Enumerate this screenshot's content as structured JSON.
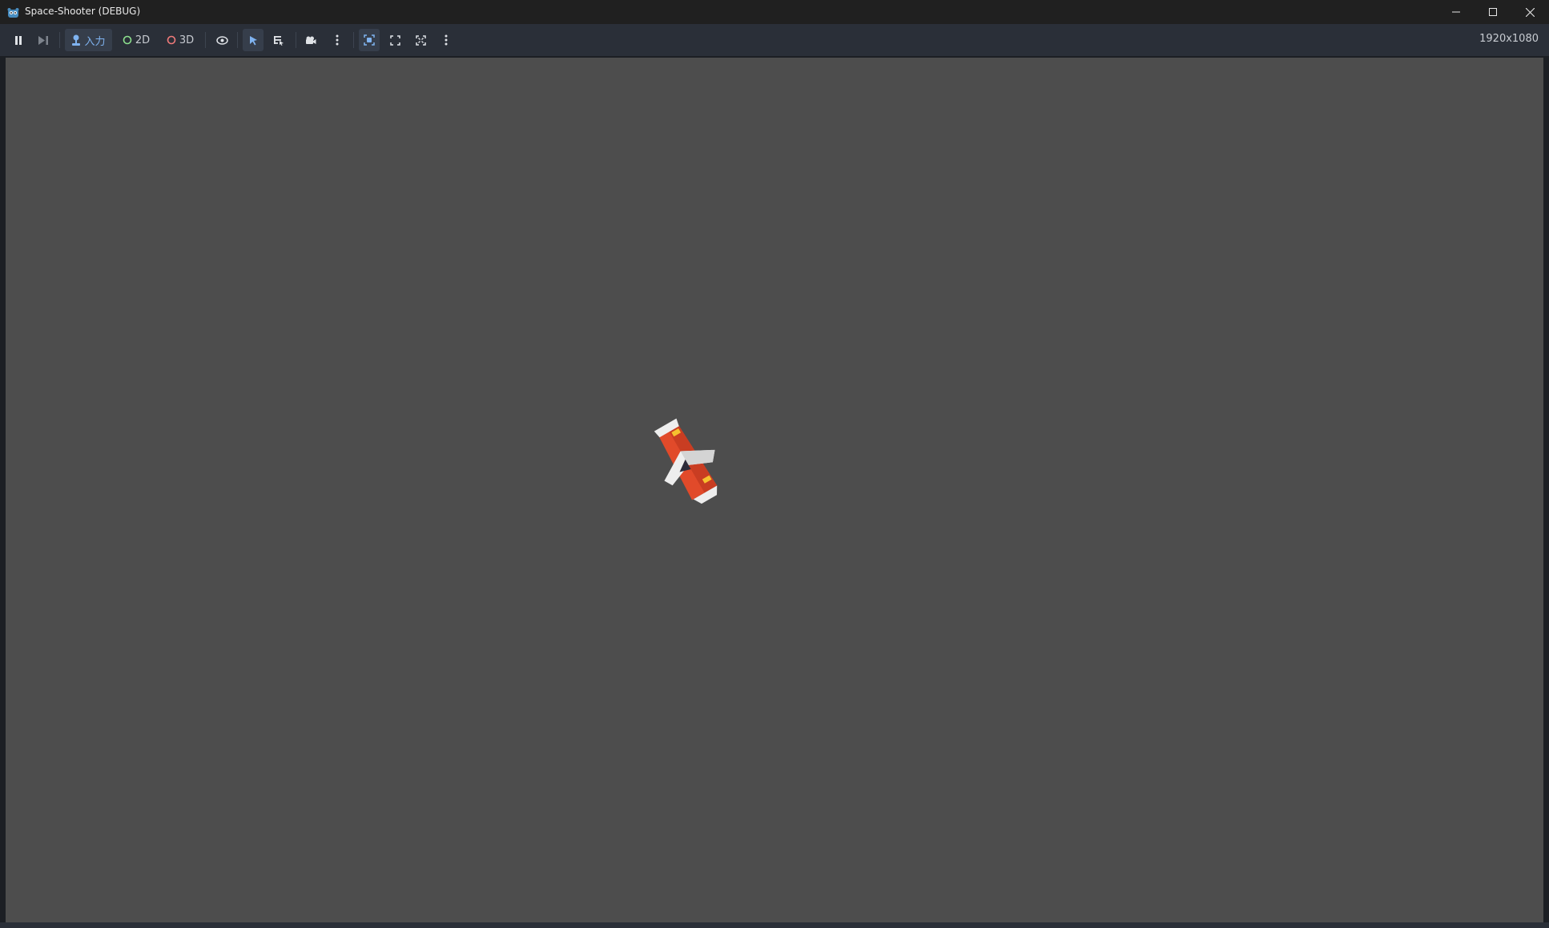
{
  "window": {
    "title": "Space-Shooter (DEBUG)",
    "app_icon": "godot-icon"
  },
  "window_controls": {
    "minimize": "minimize-icon",
    "maximize": "maximize-icon",
    "close": "close-icon"
  },
  "toolbar": {
    "pause": "pause-icon",
    "next_frame": "next-frame-icon",
    "input_label": "入力",
    "mode_2d_label": "2D",
    "mode_3d_label": "3D",
    "visibility": "eye-icon",
    "select": "cursor-icon",
    "list_select": "list-select-icon",
    "camera": "camera-icon",
    "more1": "kebab-menu-icon",
    "frame_selection": "frame-selection-icon",
    "fullscreen": "expand-icon",
    "fit": "fit-icon",
    "more2": "kebab-menu-icon",
    "resolution": "1920x1080"
  },
  "colors": {
    "titlebar": "#202020",
    "toolbar": "#2a2f38",
    "viewport": "#4d4d4d",
    "accent": "#7fb3f0",
    "mode_2d": "#8de08d",
    "mode_3d": "#f07a7a",
    "ship_red": "#e14a2a",
    "ship_white": "#eeeeee",
    "ship_yellow": "#f6c12f"
  }
}
